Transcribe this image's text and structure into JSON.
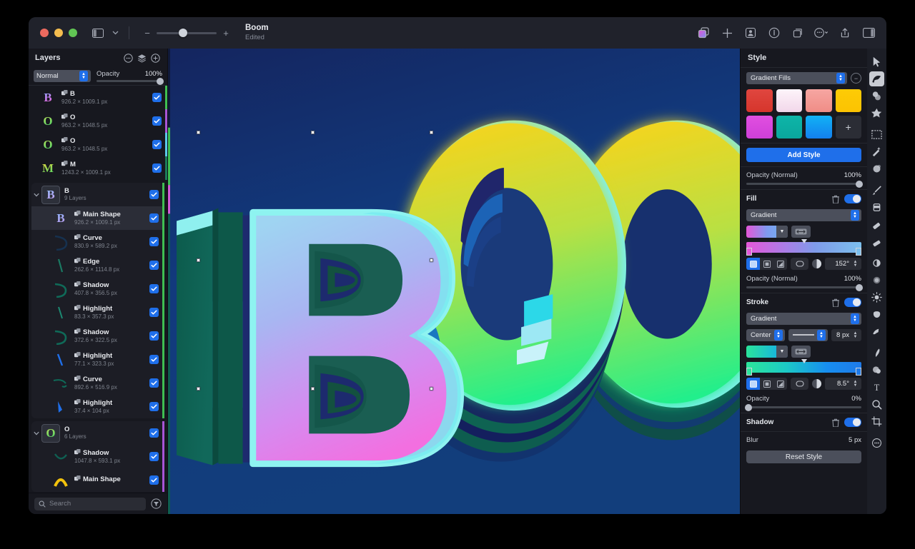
{
  "window": {
    "title": "Boom",
    "subtitle": "Edited",
    "traffic_lights": [
      "close",
      "minimize",
      "zoom"
    ],
    "zoom_minus": "−",
    "zoom_plus": "+",
    "zoom_value": 37
  },
  "toolbar_right": [
    {
      "name": "layers-compare-icon",
      "label": "Compare"
    },
    {
      "name": "plus-icon",
      "label": "Add"
    },
    {
      "name": "persona-icon",
      "label": "Persona"
    },
    {
      "name": "info-icon",
      "label": "Info"
    },
    {
      "name": "duplicate-icon",
      "label": "Duplicate"
    },
    {
      "name": "more-options-icon",
      "label": "More"
    },
    {
      "name": "share-icon",
      "label": "Share"
    },
    {
      "name": "panel-toggle-icon",
      "label": "Panels"
    }
  ],
  "layers": {
    "title": "Layers",
    "header_icons": [
      "options-icon",
      "layers-icon",
      "add-layer-icon"
    ],
    "blend_mode": "Normal",
    "opacity_label": "Opacity",
    "opacity_value": "100%",
    "search_placeholder": "Search",
    "items": [
      {
        "name": "B",
        "sub": "926.2 × 1009.1 px",
        "indent": 0,
        "kind": "layer",
        "checked": true,
        "color": "#3fbf52",
        "thumb": "B",
        "thumb_css": "linear-gradient(160deg,#7fb2ff,#c77ef0,#e84fc0)"
      },
      {
        "name": "O",
        "sub": "963.2 × 1048.5 px",
        "indent": 0,
        "kind": "layer",
        "checked": true,
        "color": "#a855d6",
        "thumb": "O",
        "thumb_css": "linear-gradient(160deg,#c9e05a,#35d46a)"
      },
      {
        "name": "O",
        "sub": "963.2 × 1048.5 px",
        "indent": 0,
        "kind": "layer",
        "checked": true,
        "color": "#5ac8e8",
        "thumb": "O",
        "thumb_css": "linear-gradient(160deg,#c9e05a,#35d46a)"
      },
      {
        "name": "M",
        "sub": "1243.2 × 1009.1 px",
        "indent": 0,
        "kind": "layer",
        "checked": true,
        "color": "#1d7a5a",
        "thumb": "M",
        "thumb_css": "linear-gradient(160deg,#f2d63c,#3fd96a)"
      },
      {
        "name": "B",
        "sub": "9 Layers",
        "indent": 0,
        "kind": "group",
        "checked": true,
        "color": "#3fbf52",
        "thumb": "B",
        "thumb_css": "linear-gradient(160deg,#8fc2ff,#cf9bf5)"
      },
      {
        "name": "Main Shape",
        "sub": "926.2 × 1009.1 px",
        "indent": 1,
        "kind": "layer",
        "checked": true,
        "color": "#3fbf52",
        "selected": true,
        "thumb": "B",
        "thumb_css": "linear-gradient(160deg,#89b8ff,#c79bf0)"
      },
      {
        "name": "Curve",
        "sub": "830.9 × 589.2 px",
        "indent": 1,
        "kind": "stroke",
        "checked": true,
        "color": "#3fbf52",
        "glyph": "curve-d"
      },
      {
        "name": "Edge",
        "sub": "262.6 × 1114.8 px",
        "indent": 1,
        "kind": "stroke",
        "checked": true,
        "color": "#3fbf52",
        "glyph": "edge-line"
      },
      {
        "name": "Shadow",
        "sub": "407.8 × 356.5 px",
        "indent": 1,
        "kind": "stroke",
        "checked": true,
        "color": "#3fbf52",
        "glyph": "curve-d2"
      },
      {
        "name": "Highlight",
        "sub": "83.3 × 357.3 px",
        "indent": 1,
        "kind": "stroke",
        "checked": true,
        "color": "#3fbf52",
        "glyph": "thin-line"
      },
      {
        "name": "Shadow",
        "sub": "372.6 × 322.5 px",
        "indent": 1,
        "kind": "stroke",
        "checked": true,
        "color": "#3fbf52",
        "glyph": "curve-d2"
      },
      {
        "name": "Highlight",
        "sub": "77.1 × 323.3 px",
        "indent": 1,
        "kind": "stroke",
        "checked": true,
        "color": "#3fbf52",
        "glyph": "blue-line"
      },
      {
        "name": "Curve",
        "sub": "892.6 × 516.9 px",
        "indent": 1,
        "kind": "stroke",
        "checked": true,
        "color": "#3fbf52",
        "glyph": "curve-wide"
      },
      {
        "name": "Highlight",
        "sub": "37.4 × 104 px",
        "indent": 1,
        "kind": "stroke",
        "checked": true,
        "color": "#3fbf52",
        "glyph": "blue-blade"
      },
      {
        "name": "O",
        "sub": "6 Layers",
        "indent": 0,
        "kind": "group",
        "checked": true,
        "color": "#a855d6",
        "thumb": "O",
        "thumb_css": "linear-gradient(160deg,#c9e05a,#35d46a)"
      },
      {
        "name": "Shadow",
        "sub": "1047.8 × 593.1 px",
        "indent": 1,
        "kind": "stroke",
        "checked": true,
        "color": "#a855d6",
        "glyph": "arc-dark"
      },
      {
        "name": "Main Shape",
        "sub": "",
        "indent": 1,
        "kind": "stroke",
        "checked": true,
        "color": "#a855d6",
        "glyph": "arc-yellow"
      }
    ]
  },
  "style": {
    "title": "Style",
    "preset_dropdown": "Gradient Fills",
    "swatches": [
      {
        "name": "swatch-red",
        "css": "linear-gradient(180deg,#e0463f,#d6352c)"
      },
      {
        "name": "swatch-white-pink",
        "css": "linear-gradient(180deg,#fdf4fa,#f2d7ea)"
      },
      {
        "name": "swatch-salmon",
        "css": "linear-gradient(180deg,#f6a6a2,#f08d86)"
      },
      {
        "name": "swatch-yellow",
        "css": "linear-gradient(180deg,#fdcb06,#fcc302)"
      },
      {
        "name": "swatch-magenta",
        "css": "linear-gradient(180deg,#e14fe0,#cf3fd8)"
      },
      {
        "name": "swatch-teal",
        "css": "linear-gradient(180deg,#0eb5a8,#0aa79d)"
      },
      {
        "name": "swatch-blue",
        "css": "linear-gradient(180deg,#12b2f5,#1380ee)"
      }
    ],
    "add_swatch_glyph": "+",
    "add_style_label": "Add Style",
    "opacity_main": {
      "label": "Opacity (Normal)",
      "value": "100%",
      "pct": 100
    },
    "fill": {
      "title": "Fill",
      "enabled": true,
      "type": "Gradient",
      "gradient_css": "linear-gradient(90deg,#e457d8,#7f9af0,#6fb7ef)",
      "bar_css": "linear-gradient(90deg,#e457d8 0%,#a97fe8 35%,#7f9be9 60%,#7cc0ee 100%)",
      "angle": "152°",
      "opacity": {
        "label": "Opacity (Normal)",
        "value": "100%",
        "pct": 100
      }
    },
    "stroke": {
      "title": "Stroke",
      "enabled": true,
      "type": "Gradient",
      "align": "Center",
      "width": "8 px",
      "gradient_css": "linear-gradient(90deg,#2ae49a,#12a6f2)",
      "bar_css": "linear-gradient(90deg,#2ce59a 0%,#1cc9c6 35%,#178ef0 70%,#1f7ae8 100%)",
      "angle": "8.5°",
      "opacity": {
        "label": "Opacity",
        "value": "0%",
        "pct": 0
      }
    },
    "shadow": {
      "title": "Shadow",
      "enabled": true,
      "blur_label": "Blur",
      "blur_value": "5 px"
    },
    "reset_label": "Reset Style"
  },
  "tools": [
    {
      "name": "move-tool-icon",
      "glyph": "arrow",
      "active": false
    },
    {
      "name": "node-tool-icon",
      "glyph": "node",
      "active": true
    },
    {
      "name": "shape-tool-icon",
      "glyph": "circles",
      "active": false
    },
    {
      "name": "star-tool-icon",
      "glyph": "star",
      "active": false
    },
    {
      "name": "selection-brush-icon",
      "glyph": "marquee",
      "active": false
    },
    {
      "name": "flood-select-icon",
      "glyph": "wand",
      "active": false
    },
    {
      "name": "paint-mixer-icon",
      "glyph": "mixer",
      "active": false
    },
    {
      "name": "paint-brush-icon",
      "glyph": "brush",
      "active": false
    },
    {
      "name": "paint-bucket-icon",
      "glyph": "bucket",
      "active": false
    },
    {
      "name": "eraser-tool-icon",
      "glyph": "eraser",
      "active": false
    },
    {
      "name": "erase-brush-icon",
      "glyph": "eraser2",
      "active": false
    },
    {
      "name": "smudge-tool-icon",
      "glyph": "smudge",
      "active": false
    },
    {
      "name": "blur-tool-icon",
      "glyph": "blur",
      "active": false
    },
    {
      "name": "dodge-tool-icon",
      "glyph": "dodge",
      "active": false
    },
    {
      "name": "sponge-tool-icon",
      "glyph": "sponge",
      "active": false
    },
    {
      "name": "clone-tool-icon",
      "glyph": "clone",
      "active": false
    },
    {
      "name": "pen-tool-icon",
      "glyph": "pen",
      "active": false
    },
    {
      "name": "fill-tool-icon",
      "glyph": "fill",
      "active": false
    },
    {
      "name": "text-tool-icon",
      "glyph": "T",
      "active": false
    },
    {
      "name": "zoom-tool-icon",
      "glyph": "magnify",
      "active": false
    },
    {
      "name": "crop-tool-icon",
      "glyph": "crop",
      "active": false
    },
    {
      "name": "more-tools-icon",
      "glyph": "ellipsis",
      "active": false
    }
  ],
  "canvas": {
    "artwork_text": "BOO",
    "background_color": "#12306e",
    "selection_handles": 6
  }
}
